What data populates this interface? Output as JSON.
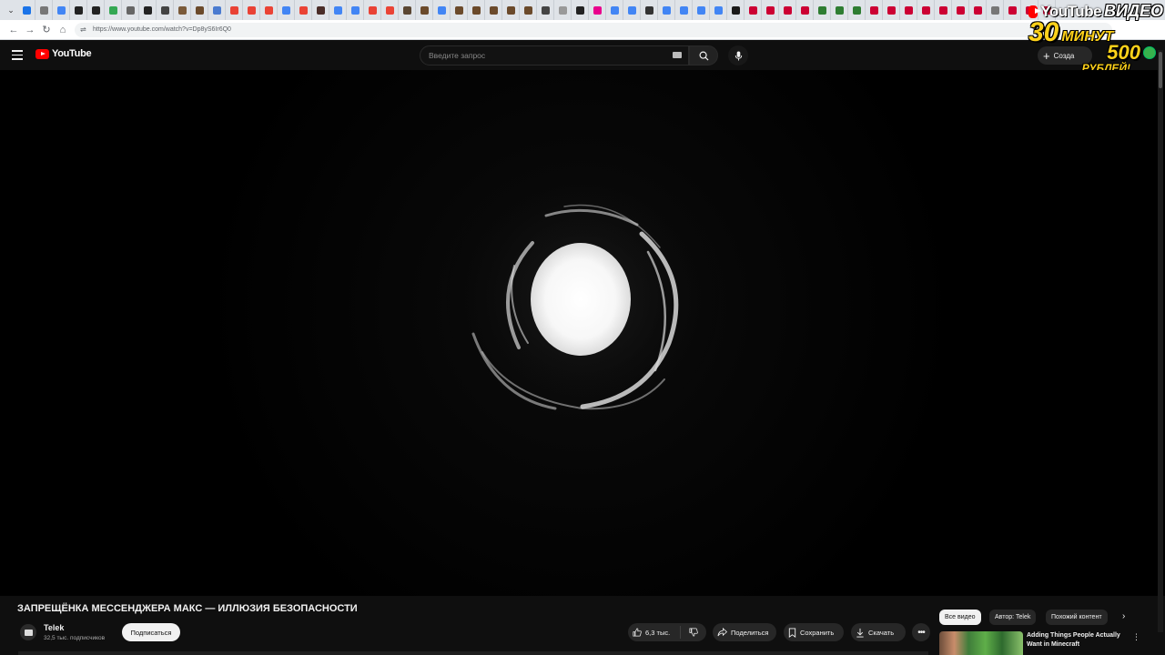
{
  "browser": {
    "url": "https://www.youtube.com/watch?v=Dp8yS6Ir6Q0",
    "tab_favicon_colors": [
      "#1a73e8",
      "#777777",
      "#4285f4",
      "#222222",
      "#222222",
      "#34a853",
      "#666666",
      "#222222",
      "#444444",
      "#7a5a3a",
      "#6b4a2b",
      "#4a7bd0",
      "#e94235",
      "#e94235",
      "#ea4335",
      "#4285f4",
      "#ea4335",
      "#4a2d28",
      "#4285f4",
      "#4285f4",
      "#e94235",
      "#ea4335",
      "#5a4632",
      "#6b4a2b",
      "#4285f4",
      "#6b4a2b",
      "#6b4a2b",
      "#6b4a2b",
      "#6b4a2b",
      "#6b4a2b",
      "#444444",
      "#999999",
      "#222222",
      "#e9008c",
      "#4285f4",
      "#4285f4",
      "#333333",
      "#4285f4",
      "#4285f4",
      "#4285f4",
      "#4285f4",
      "#1a1a1a",
      "#cc0033",
      "#cc0033",
      "#cc0033",
      "#cc0033",
      "#2e7d32",
      "#2e7d32",
      "#2e7d32",
      "#cc0033",
      "#cc0033",
      "#cc0033",
      "#cc0033",
      "#cc0033",
      "#cc0033",
      "#cc0033",
      "#777777",
      "#cc0033",
      "#cc0033",
      "#cc0033"
    ]
  },
  "header": {
    "logo_text": "YouTube",
    "search_placeholder": "Введите запрос",
    "create_label": "Созда"
  },
  "promo": {
    "youtube_word": "YouTube",
    "video_word": "ВИДЕО",
    "number_30": "30",
    "minutes_word": "МИНУТ",
    "number_500": "500",
    "rubles_word": "РУБЛЕЙ!"
  },
  "video": {
    "title": "ЗАПРЕЩЁНКА МЕССЕНДЖЕРА МАКС — ИЛЛЮЗИЯ БЕЗОПАСНОСТИ",
    "channel_name": "Telek",
    "subscribers": "32,5 тыс. подписчиков",
    "subscribe_label": "Подписаться",
    "likes": "6,3 тыс.",
    "share_label": "Поделиться",
    "save_label": "Сохранить",
    "download_label": "Скачать"
  },
  "sidebar": {
    "chips": [
      "Все видео",
      "Автор: Telek",
      "Похожий контент"
    ],
    "recommendation_title": "Adding Things People Actually Want in Minecraft"
  },
  "colors": {
    "accent": "#ff0000",
    "background": "#0f0f0f",
    "promo_yellow": "#ffd21a"
  }
}
